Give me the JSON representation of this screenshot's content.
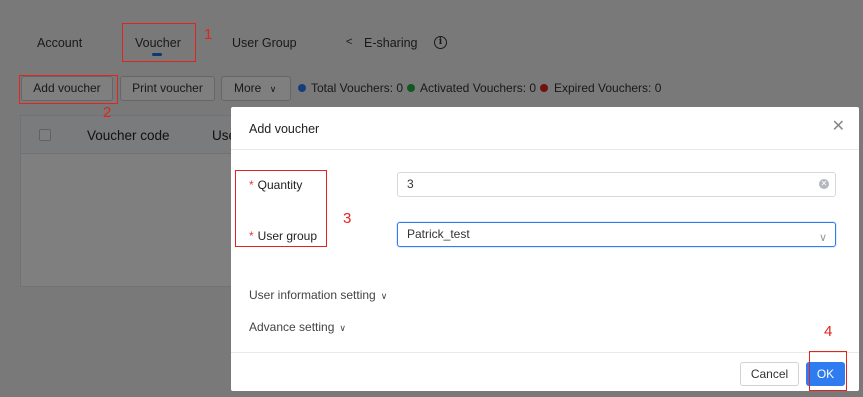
{
  "tabs": [
    {
      "label": "Account"
    },
    {
      "label": "Voucher"
    },
    {
      "label": "User Group"
    },
    {
      "label": "E-sharing"
    }
  ],
  "toolbar": {
    "add_voucher": "Add voucher",
    "print_voucher": "Print voucher",
    "more": "More"
  },
  "stats": {
    "total": "Total Vouchers: 0",
    "activated": "Activated Vouchers: 0",
    "expired": "Expired Vouchers: 0",
    "total_color": "#2f7bf0",
    "activated_color": "#27ae3c",
    "expired_color": "#e0241f"
  },
  "table": {
    "columns": [
      "Voucher code",
      "Use"
    ]
  },
  "modal": {
    "title": "Add voucher",
    "quantity_label": "Quantity",
    "quantity_value": "3",
    "user_group_label": "User group",
    "user_group_value": "Patrick_test",
    "user_info_setting": "User information setting",
    "advance_setting": "Advance setting",
    "cancel": "Cancel",
    "ok": "OK"
  },
  "annotations": [
    "1",
    "2",
    "3",
    "4"
  ]
}
